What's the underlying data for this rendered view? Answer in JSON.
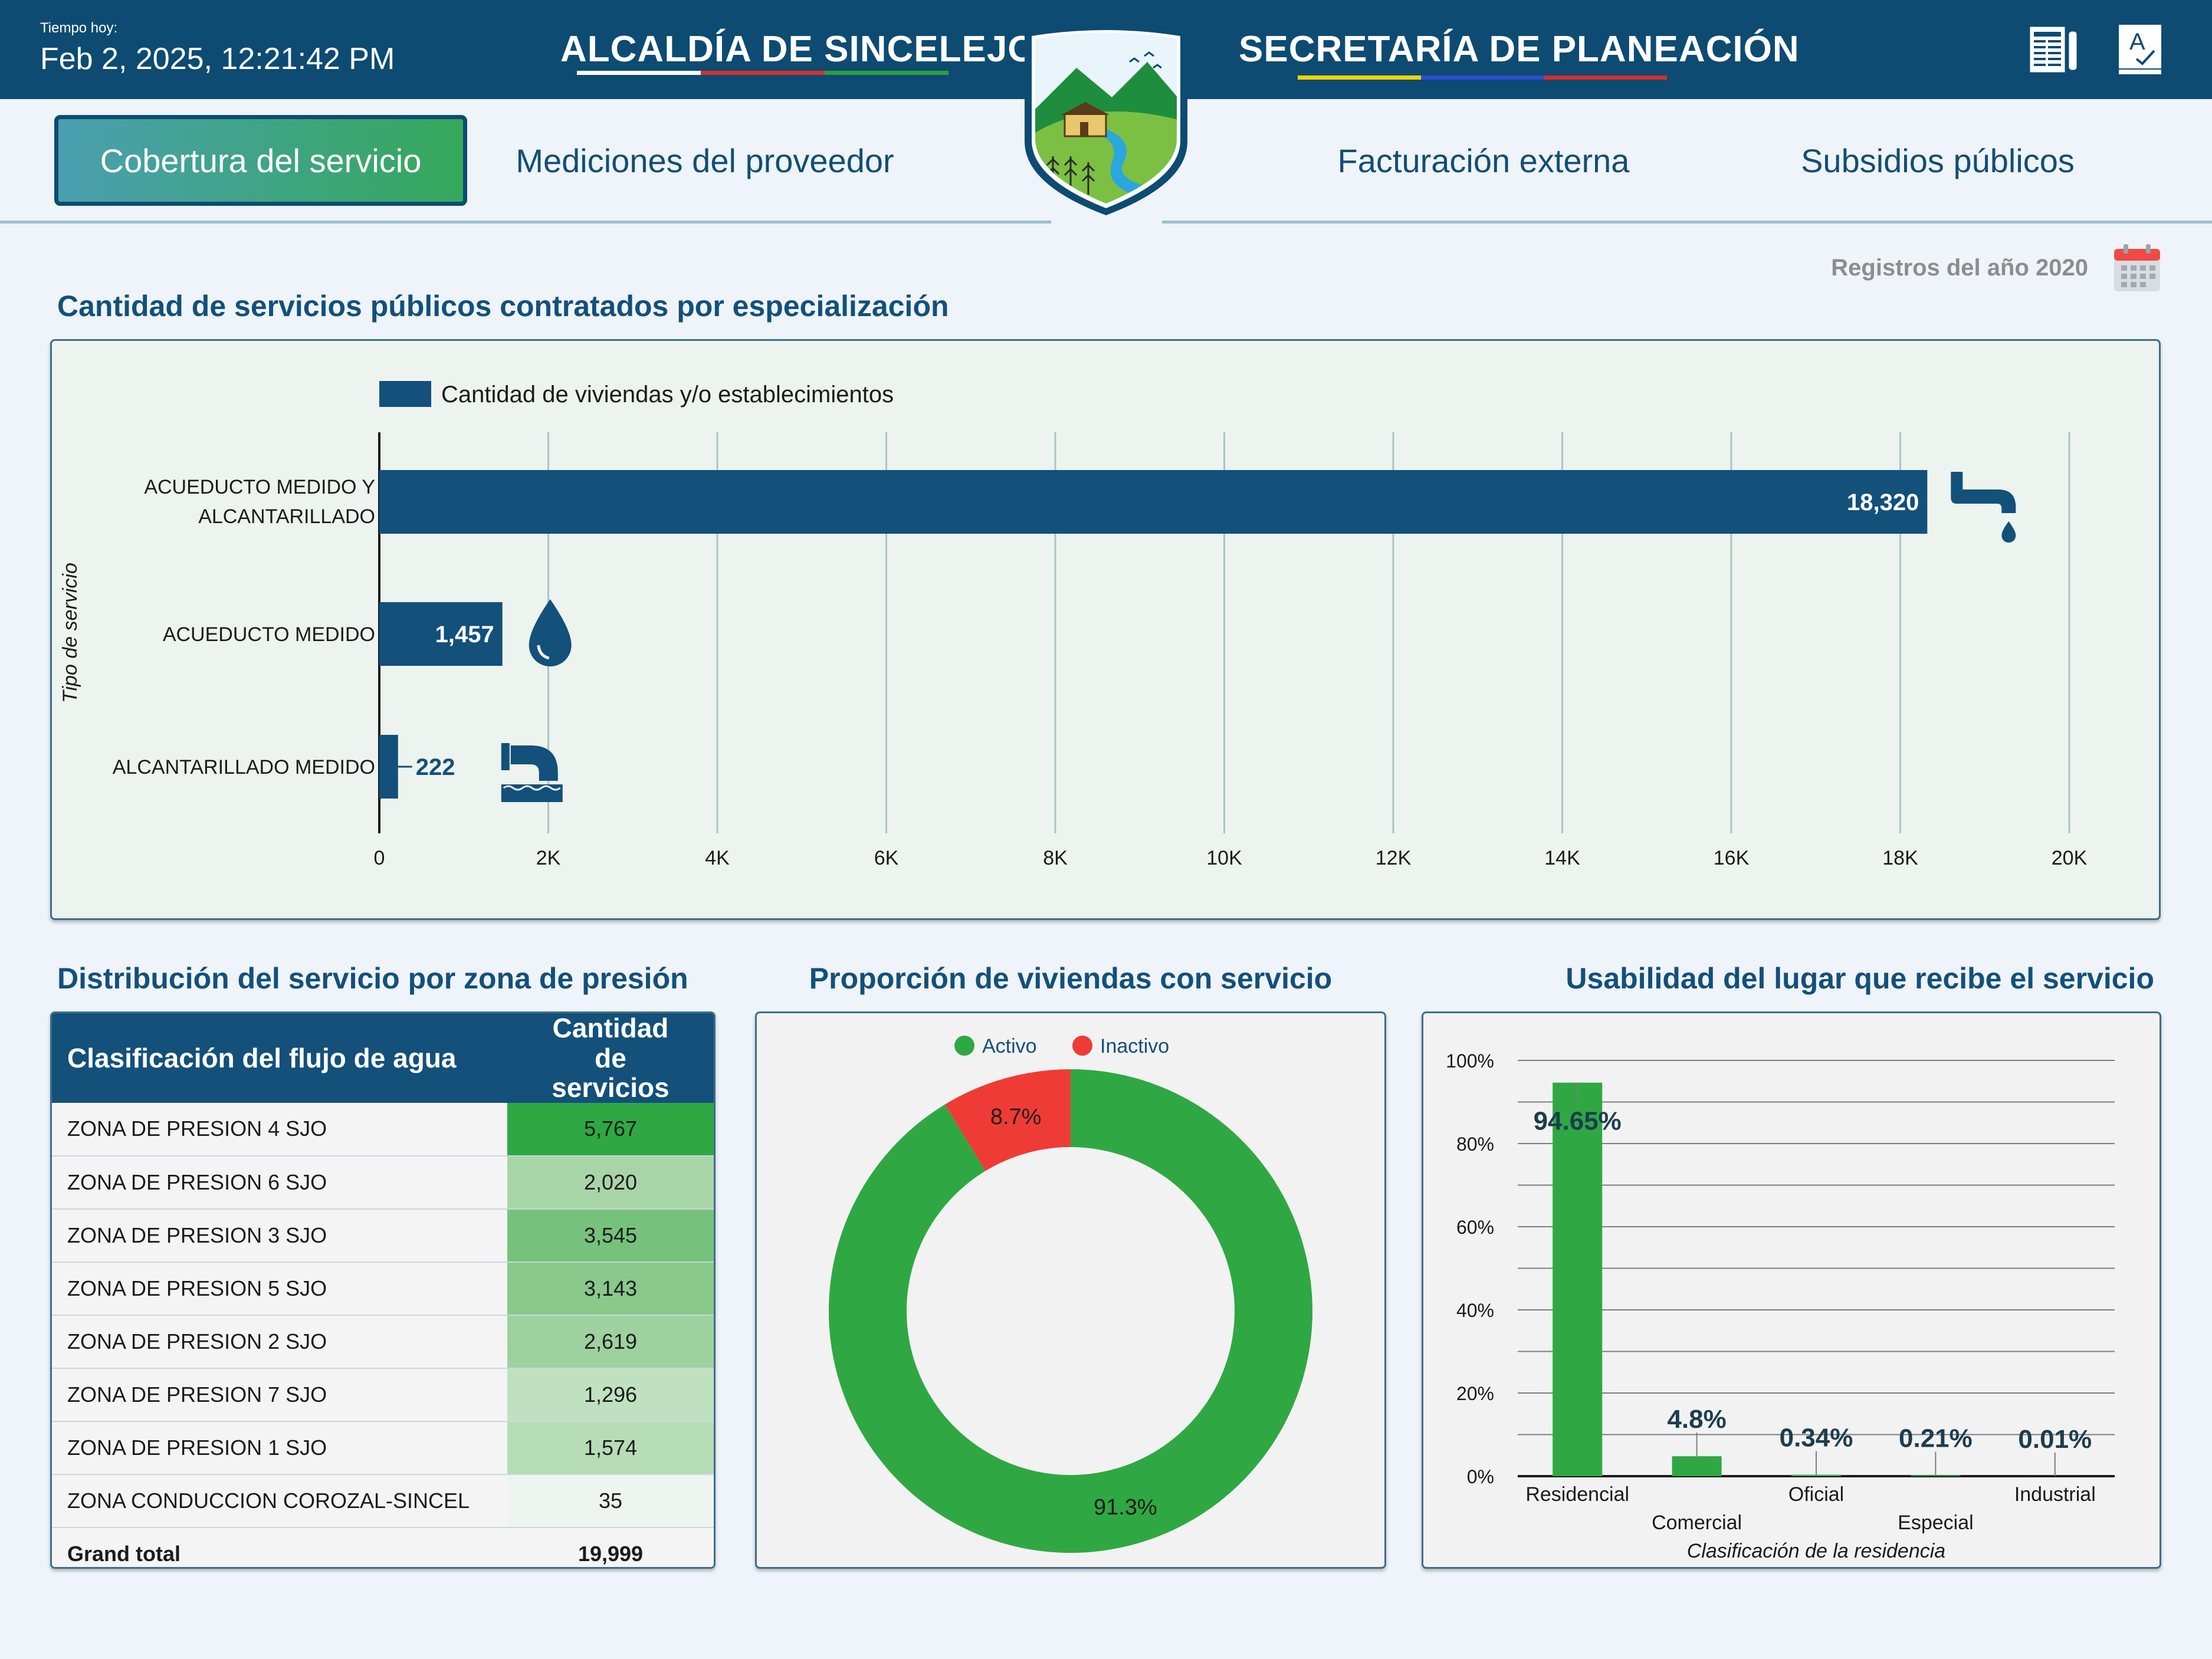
{
  "header": {
    "time_label": "Tiempo hoy:",
    "datetime": "Feb 2, 2025, 12:21:42 PM",
    "left_title": "ALCALDÍA DE SINCELEJO",
    "right_title": "SECRETARÍA DE PLANEACIÓN",
    "icons": [
      "report-icon",
      "dictionary-icon"
    ],
    "left_underline_colors": [
      "#ffffff",
      "#d32f2f",
      "#2e9e45"
    ],
    "right_underline_colors": [
      "#f2d600",
      "#2a4fd0",
      "#d32f2f"
    ]
  },
  "nav": {
    "tabs": [
      {
        "label": "Cobertura del servicio",
        "active": true
      },
      {
        "label": "Mediciones del proveedor",
        "active": false
      },
      {
        "label": "Facturación externa",
        "active": false
      },
      {
        "label": "Subsidios públicos",
        "active": false
      }
    ]
  },
  "filter": {
    "label": "Registros del año 2020",
    "icon": "calendar-icon"
  },
  "sections": {
    "bar_title": "Cantidad de servicios públicos contratados por especialización",
    "table_title": "Distribución del servicio por zona de presión",
    "donut_title": "Proporción de viviendas con servicio",
    "usage_title": "Usabilidad del lugar que recibe el servicio"
  },
  "colors": {
    "primary": "#13507a",
    "active": "#2fa843",
    "inactive": "#ef3b36",
    "background": "#eef4f9"
  },
  "chart_data": [
    {
      "type": "bar",
      "orientation": "horizontal",
      "legend": "Cantidad de viviendas y/o establecimientos",
      "ylabel": "Tipo de servicio",
      "categories": [
        [
          "ACUEDUCTO MEDIDO Y",
          "ALCANTARILLADO"
        ],
        [
          "ACUEDUCTO MEDIDO"
        ],
        [
          "ALCANTARILLADO MEDIDO"
        ]
      ],
      "values": [
        18320,
        1457,
        222
      ],
      "value_labels": [
        "18,320",
        "1,457",
        "222"
      ],
      "icons": [
        "faucet-icon",
        "water-drop-icon",
        "sewer-pipe-icon"
      ],
      "xlim": [
        0,
        20000
      ],
      "ticks": [
        0,
        2000,
        4000,
        6000,
        8000,
        10000,
        12000,
        14000,
        16000,
        18000,
        20000
      ],
      "tick_labels": [
        "0",
        "2K",
        "4K",
        "6K",
        "8K",
        "10K",
        "12K",
        "14K",
        "16K",
        "18K",
        "20K"
      ],
      "grid": true
    },
    {
      "type": "table",
      "columns": [
        "Clasificación del flujo de agua",
        "Cantidad de servicios"
      ],
      "rows": [
        [
          "ZONA DE PRESION 4 SJO",
          "5,767"
        ],
        [
          "ZONA DE PRESION 6 SJO",
          "2,020"
        ],
        [
          "ZONA DE PRESION 3 SJO",
          "3,545"
        ],
        [
          "ZONA DE PRESION 5 SJO",
          "3,143"
        ],
        [
          "ZONA DE PRESION 2 SJO",
          "2,619"
        ],
        [
          "ZONA DE PRESION 7 SJO",
          "1,296"
        ],
        [
          "ZONA DE PRESION 1 SJO",
          "1,574"
        ],
        [
          "ZONA CONDUCCION COROZAL-SINCEL",
          "35"
        ]
      ],
      "heat_colors": [
        "#2fa843",
        "#a8d5a8",
        "#76c27c",
        "#89c98c",
        "#9dd19f",
        "#bfe1bf",
        "#b6ddb6",
        "#eef4ef"
      ],
      "total_label": "Grand total",
      "total_value": "19,999"
    },
    {
      "type": "pie",
      "donut": true,
      "legend": [
        "Activo",
        "Inactivo"
      ],
      "values": [
        91.3,
        8.7
      ],
      "value_labels": [
        "91.3%",
        "8.7%"
      ],
      "colors": [
        "#2fa843",
        "#ef3b36"
      ]
    },
    {
      "type": "bar",
      "categories": [
        "Residencial",
        "Comercial",
        "Oficial",
        "Especial",
        "Industrial"
      ],
      "values": [
        94.65,
        4.8,
        0.34,
        0.21,
        0.01
      ],
      "value_labels": [
        "94.65%",
        "4.8%",
        "0.34%",
        "0.21%",
        "0.01%"
      ],
      "xlabel": "Clasificación de la residencia",
      "ylim": [
        0,
        100
      ],
      "y_ticks": [
        "0%",
        "20%",
        "40%",
        "60%",
        "80%",
        "100%"
      ],
      "grid": true,
      "color": "#2fa843"
    }
  ]
}
